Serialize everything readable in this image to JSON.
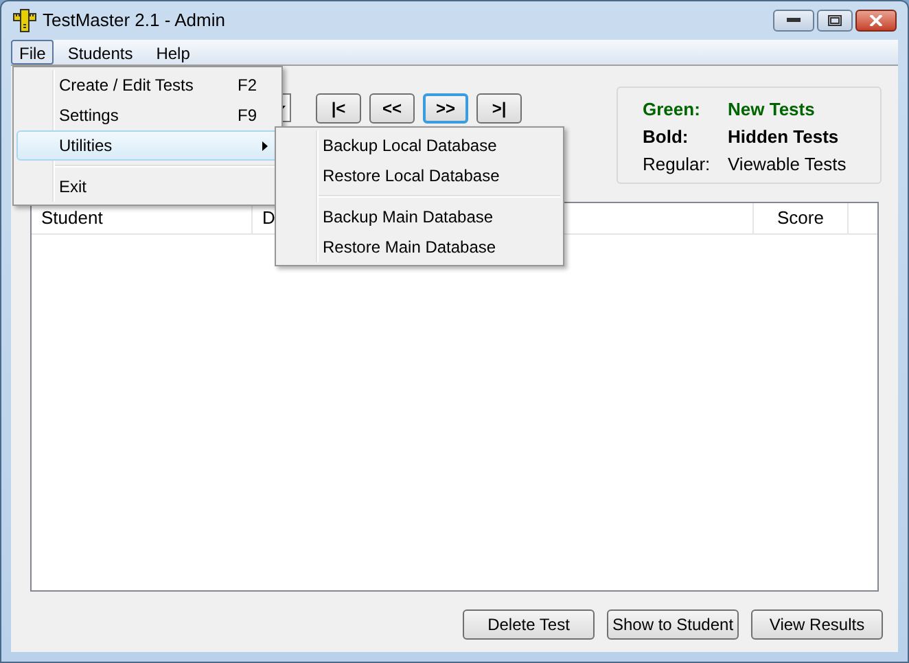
{
  "window": {
    "title": "TestMaster 2.1 - Admin"
  },
  "menu_bar": [
    {
      "label": "File",
      "selected": true
    },
    {
      "label": "Students",
      "selected": false
    },
    {
      "label": "Help",
      "selected": false
    }
  ],
  "file_menu": [
    {
      "kind": "item",
      "label": "Create / Edit Tests",
      "shortcut": "F2",
      "selected": false
    },
    {
      "kind": "item",
      "label": "Settings",
      "shortcut": "F9",
      "selected": false
    },
    {
      "kind": "submenu",
      "label": "Utilities",
      "selected": true
    },
    {
      "kind": "separator"
    },
    {
      "kind": "item",
      "label": "Exit",
      "selected": false
    }
  ],
  "utilities_menu": [
    {
      "kind": "item",
      "label": "Backup Local Database"
    },
    {
      "kind": "item",
      "label": "Restore Local Database"
    },
    {
      "kind": "separator"
    },
    {
      "kind": "item",
      "label": "Backup Main Database"
    },
    {
      "kind": "item",
      "label": "Restore Main Database"
    }
  ],
  "nav_buttons": [
    {
      "label": "|<",
      "focused": false
    },
    {
      "label": "<<",
      "focused": false
    },
    {
      "label": ">>",
      "focused": true
    },
    {
      "label": ">|",
      "focused": false
    }
  ],
  "legend": [
    {
      "kind": "green",
      "label": "Green:",
      "meaning": "New Tests"
    },
    {
      "kind": "bold",
      "label": "Bold:",
      "meaning": "Hidden Tests"
    },
    {
      "kind": "regular",
      "label": "Regular:",
      "meaning": "Viewable Tests"
    }
  ],
  "table": {
    "columns": [
      "Student",
      "D",
      "Score"
    ]
  },
  "buttons": [
    "Delete Test",
    "Show to Student",
    "View Results"
  ]
}
